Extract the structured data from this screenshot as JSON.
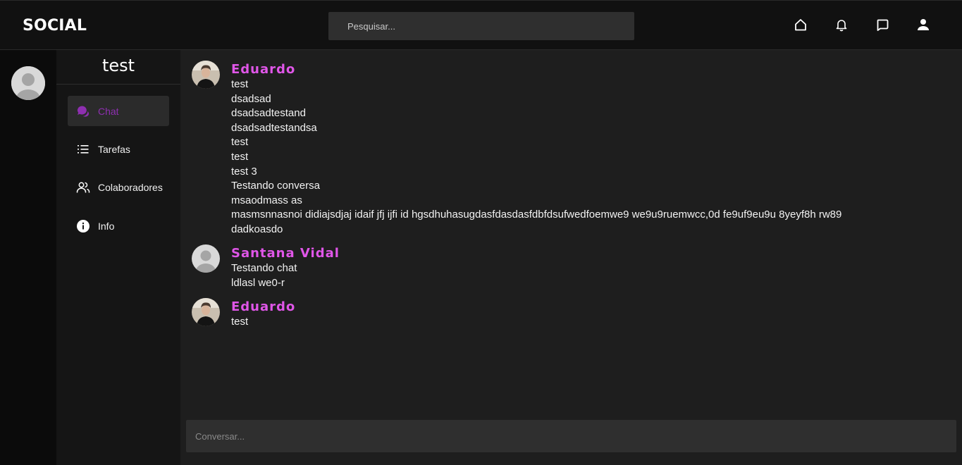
{
  "app": {
    "brand": "SOCIAL"
  },
  "search": {
    "placeholder": "Pesquisar..."
  },
  "topbar_icons": [
    "home-icon",
    "bell-icon",
    "chat-bubble-icon",
    "user-icon"
  ],
  "group": {
    "name": "test"
  },
  "nav": {
    "items": [
      {
        "label": "Chat",
        "icon": "chat-icon",
        "active": true
      },
      {
        "label": "Tarefas",
        "icon": "list-icon",
        "active": false
      },
      {
        "label": "Colaboradores",
        "icon": "users-icon",
        "active": false
      },
      {
        "label": "Info",
        "icon": "info-icon",
        "active": false
      }
    ]
  },
  "messages": [
    {
      "author": "Eduardo",
      "avatar": "photo-avatar",
      "lines": [
        "test",
        "dsadsad",
        "dsadsadtestand",
        "dsadsadtestandsa",
        "test",
        "test",
        "test 3",
        "Testando conversa",
        "msaodmass as",
        "masmsnnasnoi didiajsdjaj idaif jfj ijfi id hgsdhuhasugdasfdasdasfdbfdsufwedfoemwe9 we9u9ruemwcc,0d fe9uf9eu9u 8yeyf8h rw89",
        "dadkoasdo"
      ]
    },
    {
      "author": "Santana Vidal",
      "avatar": "default-avatar",
      "lines": [
        "Testando chat",
        "ldlasl we0-r"
      ]
    },
    {
      "author": "Eduardo",
      "avatar": "photo-avatar",
      "lines": [
        "test"
      ]
    }
  ],
  "composer": {
    "placeholder": "Conversar..."
  },
  "colors": {
    "accent": "#e056e8",
    "active_nav": "#8e2fb0",
    "topbar": "#111111",
    "panel": "#151515",
    "main": "#1e1e1e",
    "input": "#2f2f2f"
  }
}
